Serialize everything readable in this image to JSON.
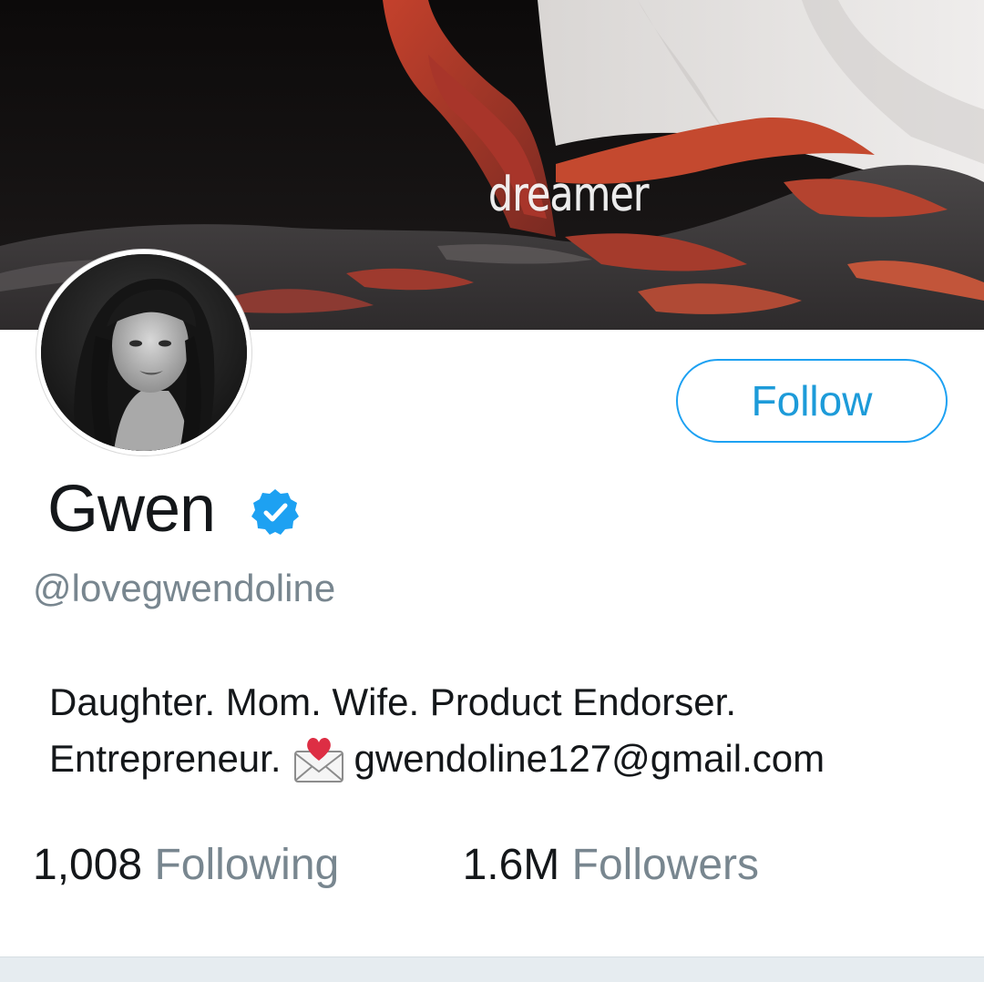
{
  "banner": {
    "caption": "dreamer"
  },
  "profile": {
    "display_name": "Gwen",
    "verified": true,
    "handle": "@lovegwendoline",
    "bio_line1": "Daughter. Mom. Wife. Product Endorser.",
    "bio_line2_prefix": "Entrepreneur.",
    "bio_email_icon": "love-letter-icon",
    "bio_line2_suffix": "gwendoline127@gmail.com"
  },
  "actions": {
    "follow_label": "Follow"
  },
  "stats": {
    "following_count": "1,008",
    "following_label": "Following",
    "followers_count": "1.6M",
    "followers_label": "Followers"
  },
  "colors": {
    "accent": "#1da1f2",
    "secondary_text": "#78868f",
    "primary_text": "#14171a"
  }
}
